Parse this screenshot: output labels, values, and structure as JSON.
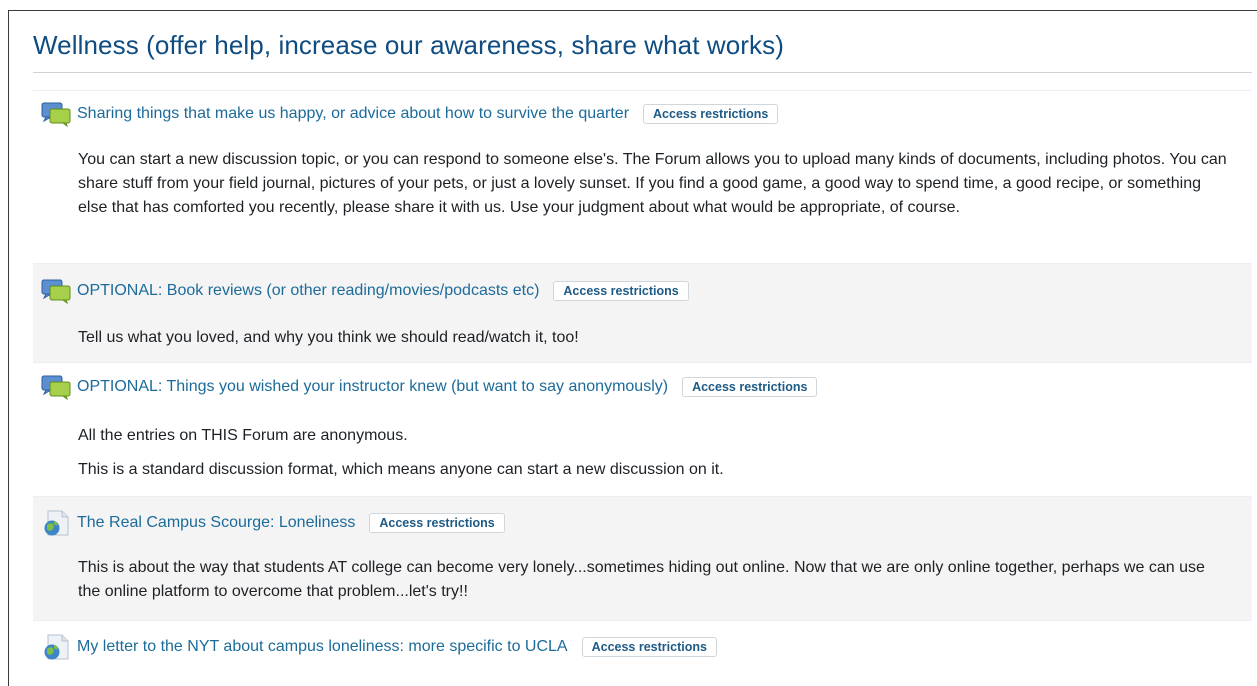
{
  "section": {
    "title": "Wellness (offer help, increase our awareness, share what works)"
  },
  "activities": [
    {
      "type_icon": "forum-icon",
      "title": "Sharing things that make us happy, or advice about how to survive the quarter",
      "badge": "Access restrictions",
      "description": [
        "You can start a new discussion topic, or you can respond to someone else's. The Forum allows you to upload many kinds of documents, including photos. You can share stuff from your field journal, pictures of your pets, or just a lovely sunset. If you find a good game, a good way to spend time, a good recipe, or something else that has comforted you recently, please share it with us. Use your judgment about what would be appropriate, of course."
      ]
    },
    {
      "type_icon": "forum-icon",
      "title": "OPTIONAL: Book reviews (or other reading/movies/podcasts etc)",
      "badge": "Access restrictions",
      "description": [
        "Tell us what you loved, and why you think we should read/watch it, too!"
      ]
    },
    {
      "type_icon": "forum-icon",
      "title": "OPTIONAL: Things you wished your instructor knew (but want to say anonymously)",
      "badge": "Access restrictions",
      "description": [
        "All the entries on THIS Forum are anonymous.",
        "This is a standard discussion format, which means anyone can start a new discussion on it."
      ]
    },
    {
      "type_icon": "url-icon",
      "title": "The Real Campus Scourge: Loneliness",
      "badge": "Access restrictions",
      "description": [
        "This is about the way that students AT college can become very lonely...sometimes hiding out online. Now that we are only online together, perhaps we can use the online platform to overcome that problem...let's try!!"
      ]
    },
    {
      "type_icon": "url-icon",
      "title": "My letter to the NYT about campus loneliness: more specific to UCLA",
      "badge": "Access restrictions",
      "description": []
    }
  ]
}
